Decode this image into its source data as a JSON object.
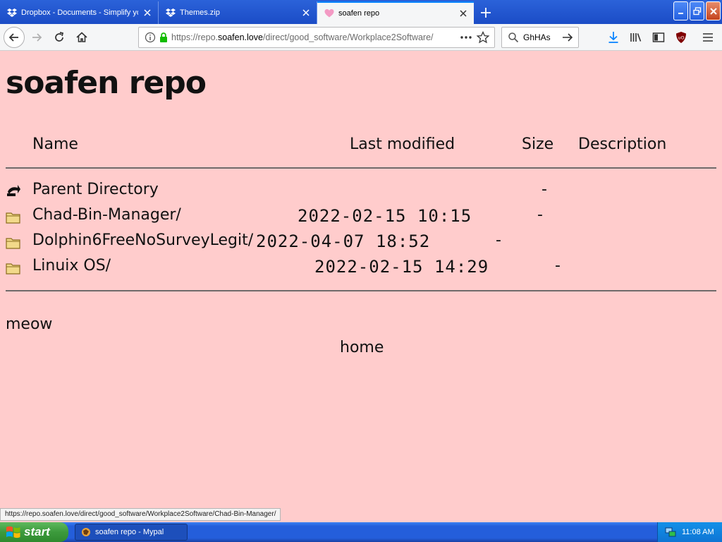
{
  "browser": {
    "tabs": [
      {
        "title": "Dropbox - Documents - Simplify yo",
        "icon": "dropbox-icon",
        "active": false
      },
      {
        "title": "Themes.zip",
        "icon": "dropbox-icon",
        "active": false
      },
      {
        "title": "soafen repo",
        "icon": "heart-icon",
        "active": true
      }
    ],
    "url_prefix": "https://repo.",
    "url_domain": "soafen.love",
    "url_path": "/direct/good_software/Workplace2Software/",
    "search_value": "GhHAs",
    "status_url": "https://repo.soafen.love/direct/good_software/Workplace2Software/Chad-Bin-Manager/"
  },
  "page": {
    "title": "soafen repo",
    "columns": {
      "name": "Name",
      "modified": "Last modified",
      "size": "Size",
      "description": "Description"
    },
    "rows": [
      {
        "name": "Parent Directory",
        "date": "",
        "size": "-",
        "icon": "back-arrow-icon"
      },
      {
        "name": "Chad-Bin-Manager/",
        "date": "2022-02-15 10:15",
        "size": "-",
        "icon": "folder-icon"
      },
      {
        "name": "Dolphin6FreeNoSurveyLegit/",
        "date": "2022-04-07 18:52",
        "size": "-",
        "icon": "folder-icon"
      },
      {
        "name": "Linuix OS/",
        "date": "2022-02-15 14:29",
        "size": "-",
        "icon": "folder-icon"
      }
    ],
    "footer": "meow",
    "home_link": "home"
  },
  "taskbar": {
    "start_label": "start",
    "task_label": "soafen repo - Mypal",
    "clock": "11:08 AM"
  },
  "colors": {
    "page_bg": "#ffcccc",
    "taskbar": "#245edb",
    "start": "#3c9a3c"
  }
}
